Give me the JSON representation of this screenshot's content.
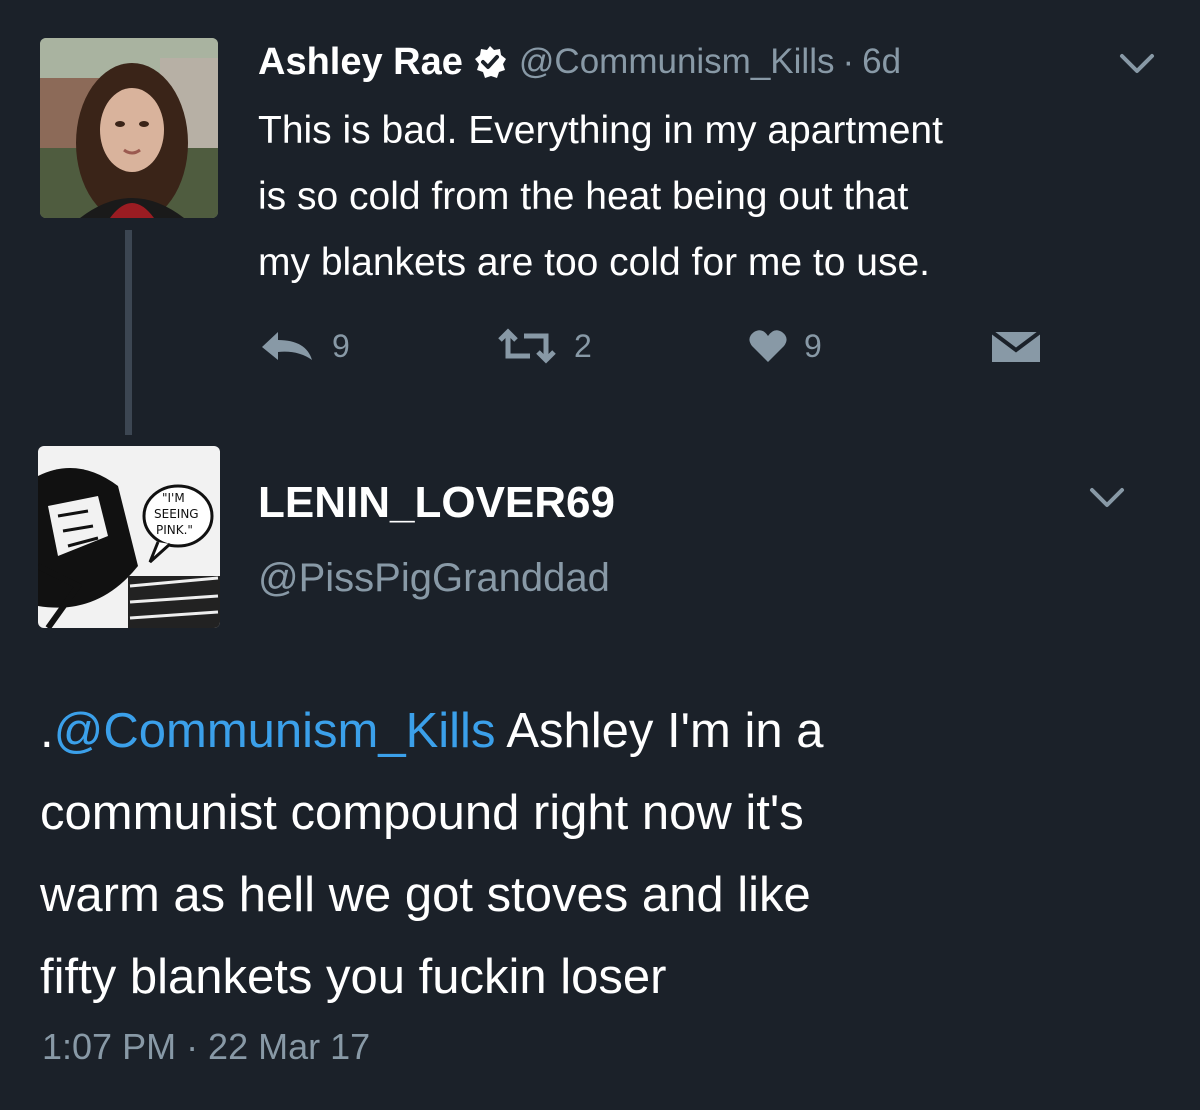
{
  "tweet1": {
    "author_name": "Ashley Rae",
    "handle": "@Communism_Kills",
    "separator": "·",
    "age": "6d",
    "text_lines": [
      "This is bad. Everything in my apartment",
      "is so cold from the heat being out that",
      "my blankets are too cold for me to use."
    ],
    "actions": {
      "reply_count": "9",
      "retweet_count": "2",
      "like_count": "9"
    }
  },
  "tweet2": {
    "display_name": "LENIN_LOVER69",
    "handle": "@PissPigGranddad",
    "text_prefix": ".",
    "mention": "@Communism_Kills",
    "text_line1_rest": " Ashley I'm in a",
    "text_lines": [
      "communist compound right now it's",
      "warm as hell we got stoves and like",
      "fifty blankets you fuckin loser"
    ],
    "timestamp": "1:07 PM · 22 Mar 17"
  },
  "colors": {
    "background": "#1b2129",
    "primary_text": "#ffffff",
    "secondary_text": "#8899a6",
    "link": "#3ba0ea",
    "thread_line": "#3c4652"
  }
}
